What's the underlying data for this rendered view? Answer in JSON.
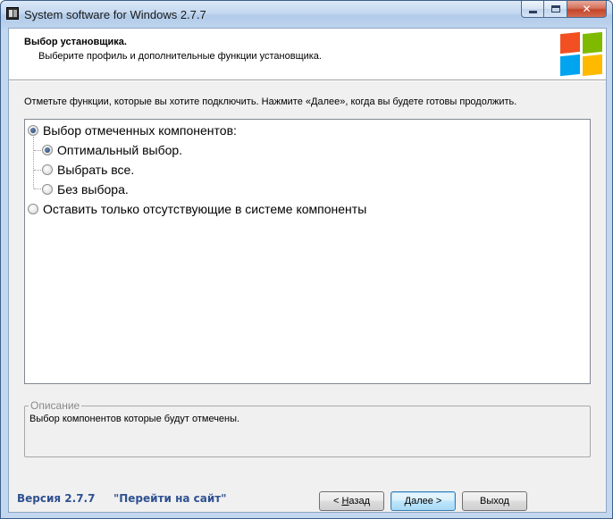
{
  "window": {
    "title": "System software for Windows 2.7.7"
  },
  "header": {
    "title": "Выбор установщика.",
    "subtitle": "Выберите профиль и дополнительные функции установщика.",
    "logo_colors": [
      "#f25022",
      "#7fba00",
      "#00a4ef",
      "#ffb900"
    ]
  },
  "instruction": "Отметьте функции, которые вы хотите подключить. Нажмите «Далее», когда вы будете готовы продолжить.",
  "options": [
    {
      "label": "Выбор отмеченных компонентов:",
      "checked": true,
      "level": 0
    },
    {
      "label": "Оптимальный выбор.",
      "checked": true,
      "level": 1
    },
    {
      "label": "Выбрать все.",
      "checked": false,
      "level": 1
    },
    {
      "label": "Без выбора.",
      "checked": false,
      "level": 1
    },
    {
      "label": "Оставить только отсутствующие в системе компоненты",
      "checked": false,
      "level": 0
    }
  ],
  "description": {
    "legend": "Описание",
    "text": "Выбор компонентов которые будут отмечены."
  },
  "footer": {
    "version": "Версия 2.7.7",
    "site_link": "\"Перейти на сайт\"",
    "back_prefix": "< ",
    "back_mnemonic": "Н",
    "back_rest": "азад",
    "next_prefix": "Д",
    "next_rest": "алее >",
    "exit": "Выход"
  },
  "colors": {
    "link": "#2f5191",
    "default_button_border": "#3c7fb1"
  }
}
